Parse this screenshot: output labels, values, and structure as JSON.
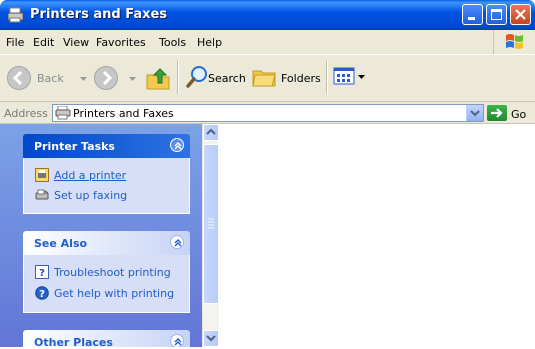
{
  "window": {
    "title": "Printers and Faxes"
  },
  "menu": {
    "items": [
      "File",
      "Edit",
      "View",
      "Favorites",
      "Tools",
      "Help"
    ]
  },
  "toolbar": {
    "back_label": "Back",
    "search_label": "Search",
    "folders_label": "Folders"
  },
  "address": {
    "label": "Address",
    "value": "Printers and Faxes",
    "go_label": "Go"
  },
  "panels": {
    "printer_tasks": {
      "title": "Printer Tasks",
      "items": [
        "Add a printer",
        "Set up faxing"
      ]
    },
    "see_also": {
      "title": "See Also",
      "items": [
        "Troubleshoot printing",
        "Get help with printing"
      ]
    },
    "other_places": {
      "title": "Other Places"
    }
  },
  "colors": {
    "title_bar": "#0054e3",
    "task_pane": "#6f8fe0",
    "link": "#215dc6"
  }
}
